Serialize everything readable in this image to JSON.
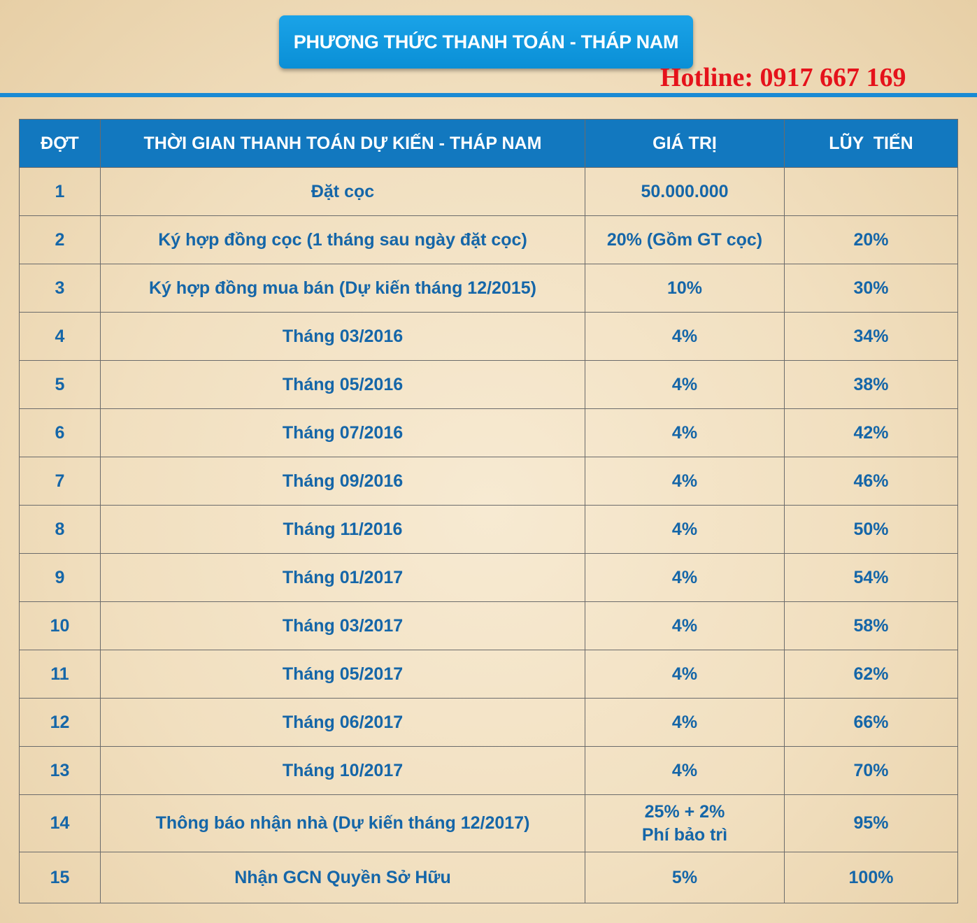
{
  "title": "PHƯƠNG THỨC THANH TOÁN - THÁP NAM",
  "hotline": "Hotline: 0917 667 169",
  "table": {
    "headers": [
      "ĐỢT",
      "THỜI GIAN THANH TOÁN DỰ KIẾN - THÁP NAM",
      "GIÁ TRỊ",
      "LŨY  TIẾN"
    ],
    "rows": [
      [
        "1",
        "Đặt cọc",
        "50.000.000",
        ""
      ],
      [
        "2",
        "Ký hợp đồng cọc (1 tháng sau ngày đặt cọc)",
        "20% (Gồm GT cọc)",
        "20%"
      ],
      [
        "3",
        "Ký hợp đồng mua bán (Dự kiến tháng 12/2015)",
        "10%",
        "30%"
      ],
      [
        "4",
        "Tháng 03/2016",
        "4%",
        "34%"
      ],
      [
        "5",
        "Tháng 05/2016",
        "4%",
        "38%"
      ],
      [
        "6",
        "Tháng 07/2016",
        "4%",
        "42%"
      ],
      [
        "7",
        "Tháng 09/2016",
        "4%",
        "46%"
      ],
      [
        "8",
        "Tháng 11/2016",
        "4%",
        "50%"
      ],
      [
        "9",
        "Tháng 01/2017",
        "4%",
        "54%"
      ],
      [
        "10",
        "Tháng 03/2017",
        "4%",
        "58%"
      ],
      [
        "11",
        "Tháng 05/2017",
        "4%",
        "62%"
      ],
      [
        "12",
        "Tháng 06/2017",
        "4%",
        "66%"
      ],
      [
        "13",
        "Tháng 10/2017",
        "4%",
        "70%"
      ],
      [
        "14",
        "Thông báo nhận nhà (Dự kiến tháng 12/2017)",
        "25% + 2%\nPhí bảo trì",
        "95%"
      ],
      [
        "15",
        "Nhận GCN Quyền Sở Hữu",
        "5%",
        "100%"
      ]
    ]
  }
}
